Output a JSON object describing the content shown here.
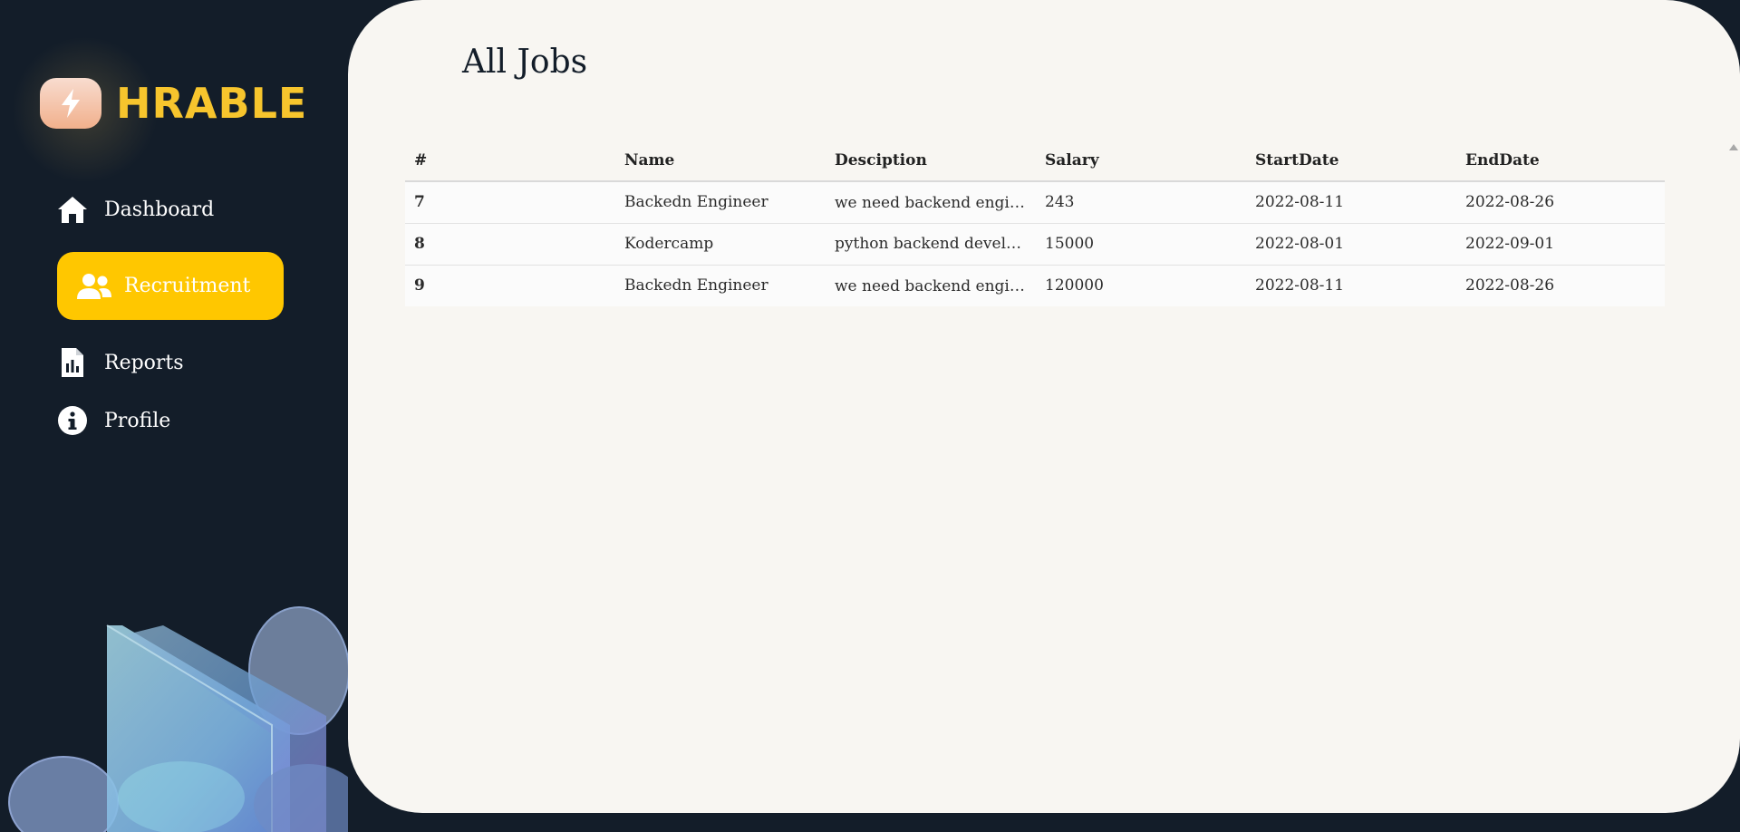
{
  "brand": {
    "name": "HRABLE",
    "accent": "#f7c52d",
    "active_bg": "#ffc700"
  },
  "sidebar": {
    "items": [
      {
        "label": "Dashboard",
        "icon": "home-icon"
      },
      {
        "label": "Recruitment",
        "icon": "users-icon",
        "active": true
      },
      {
        "label": "Reports",
        "icon": "report-file-icon"
      },
      {
        "label": "Profile",
        "icon": "info-icon"
      }
    ]
  },
  "main": {
    "title": "All Jobs",
    "table": {
      "headers": [
        "#",
        "Name",
        "Desciption",
        "Salary",
        "StartDate",
        "EndDate"
      ],
      "rows": [
        {
          "id": "7",
          "name": "Backedn Engineer",
          "description": "we need backend engin...",
          "salary": "243",
          "start": "2022-08-11",
          "end": "2022-08-26"
        },
        {
          "id": "8",
          "name": "Kodercamp",
          "description": "python backend develo...",
          "salary": "15000",
          "start": "2022-08-01",
          "end": "2022-09-01"
        },
        {
          "id": "9",
          "name": "Backedn Engineer",
          "description": "we need backend engin...",
          "salary": "120000",
          "start": "2022-08-11",
          "end": "2022-08-26"
        }
      ]
    }
  }
}
